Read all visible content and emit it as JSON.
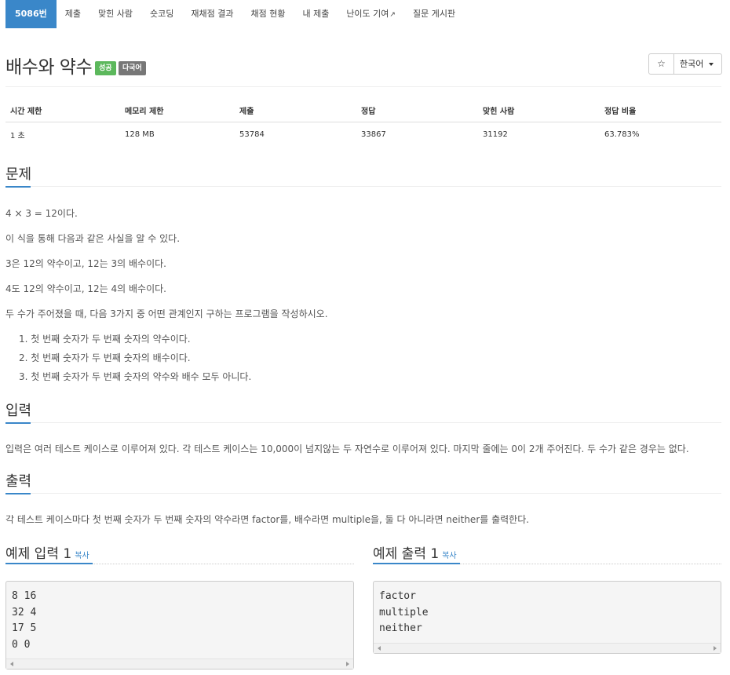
{
  "nav": {
    "tabs": [
      "5086번",
      "제출",
      "맞힌 사람",
      "숏코딩",
      "재채점 결과",
      "채점 현황",
      "내 제출",
      "난이도 기여",
      "질문 게시판"
    ]
  },
  "problem": {
    "title": "배수와 약수",
    "badge_success": "성공",
    "badge_lang": "다국어",
    "star_icon": "☆",
    "lang_button": "한국어"
  },
  "stats": {
    "headers": [
      "시간 제한",
      "메모리 제한",
      "제출",
      "정답",
      "맞힌 사람",
      "정답 비율"
    ],
    "values": [
      "1 초",
      "128 MB",
      "53784",
      "33867",
      "31192",
      "63.783%"
    ]
  },
  "sections": {
    "problem": "문제",
    "input": "입력",
    "output": "출력"
  },
  "problem_body": {
    "lines": [
      "4 × 3 = 12이다.",
      "이 식을 통해 다음과 같은 사실을 알 수 있다.",
      "3은 12의 약수이고, 12는 3의 배수이다.",
      "4도 12의 약수이고, 12는 4의 배수이다.",
      "두 수가 주어졌을 때, 다음 3가지 중 어떤 관계인지 구하는 프로그램을 작성하시오."
    ],
    "list": [
      "1. 첫 번째 숫자가 두 번째 숫자의 약수이다.",
      "2. 첫 번째 숫자가 두 번째 숫자의 배수이다.",
      "3. 첫 번째 숫자가 두 번째 숫자의 약수와 배수 모두 아니다."
    ]
  },
  "input_body": "입력은 여러 테스트 케이스로 이루어져 있다. 각 테스트 케이스는 10,000이 넘지않는 두 자연수로 이루어져 있다. 마지막 줄에는 0이 2개 주어진다. 두 수가 같은 경우는 없다.",
  "output_body": "각 테스트 케이스마다 첫 번째 숫자가 두 번째 숫자의 약수라면 factor를, 배수라면 multiple을, 둘 다 아니라면 neither를 출력한다.",
  "examples": {
    "input_title": "예제 입력 1",
    "output_title": "예제 출력 1",
    "copy_label": "복사",
    "input_lines": [
      "8 16",
      "32 4",
      "17 5",
      "0 0"
    ],
    "output_lines": [
      "factor",
      "multiple",
      "neither"
    ]
  },
  "colors": {
    "accent": "#3a87c9",
    "success": "#5cb85c",
    "muted_badge": "#777777"
  }
}
